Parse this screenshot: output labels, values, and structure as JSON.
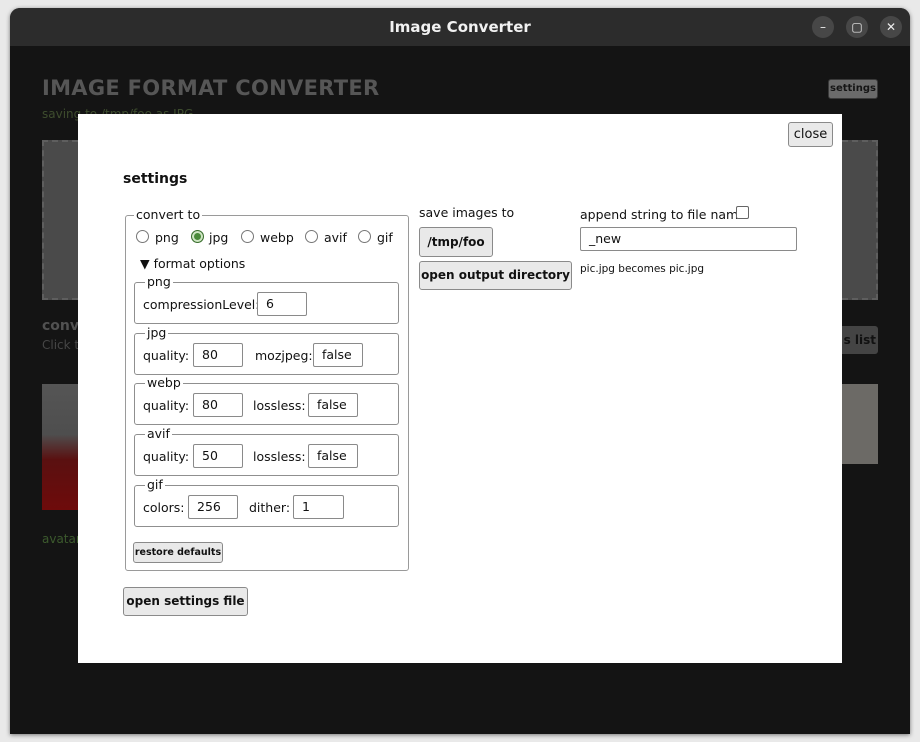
{
  "window": {
    "title": "Image Converter",
    "controls": {
      "minimize": "–",
      "maximize": "▢",
      "close": "✕"
    }
  },
  "background_app": {
    "title": "IMAGE FORMAT CONVERTER",
    "subtitle": "saving to /tmp/foo as JPG",
    "settings_button": "settings",
    "convert_heading": "conv",
    "click_hint": "Click t",
    "clear_list_button": "s list",
    "avatar_caption": "avatar"
  },
  "modal": {
    "close_label": "close",
    "heading": "settings",
    "convert_to": {
      "legend": "convert to",
      "options": [
        "png",
        "jpg",
        "webp",
        "avif",
        "gif"
      ],
      "selected": "jpg"
    },
    "format_options": {
      "summary": "▼ format options",
      "png": {
        "legend": "png",
        "compression_label": "compressionLevel:",
        "compression_value": "6"
      },
      "jpg": {
        "legend": "jpg",
        "quality_label": "quality:",
        "quality_value": "80",
        "mozjpeg_label": "mozjpeg:",
        "mozjpeg_value": "false"
      },
      "webp": {
        "legend": "webp",
        "quality_label": "quality:",
        "quality_value": "80",
        "lossless_label": "lossless:",
        "lossless_value": "false"
      },
      "avif": {
        "legend": "avif",
        "quality_label": "quality:",
        "quality_value": "50",
        "lossless_label": "lossless:",
        "lossless_value": "false"
      },
      "gif": {
        "legend": "gif",
        "colors_label": "colors:",
        "colors_value": "256",
        "dither_label": "dither:",
        "dither_value": "1"
      }
    },
    "restore_defaults_label": "restore defaults",
    "open_settings_file_label": "open settings file",
    "save_images_label": "save images to",
    "output_path": "/tmp/foo",
    "open_output_label": "open output directory",
    "append_label": "append string to file name",
    "append_checked": false,
    "append_value": "_new",
    "example_text": "pic.jpg becomes pic.jpg"
  }
}
